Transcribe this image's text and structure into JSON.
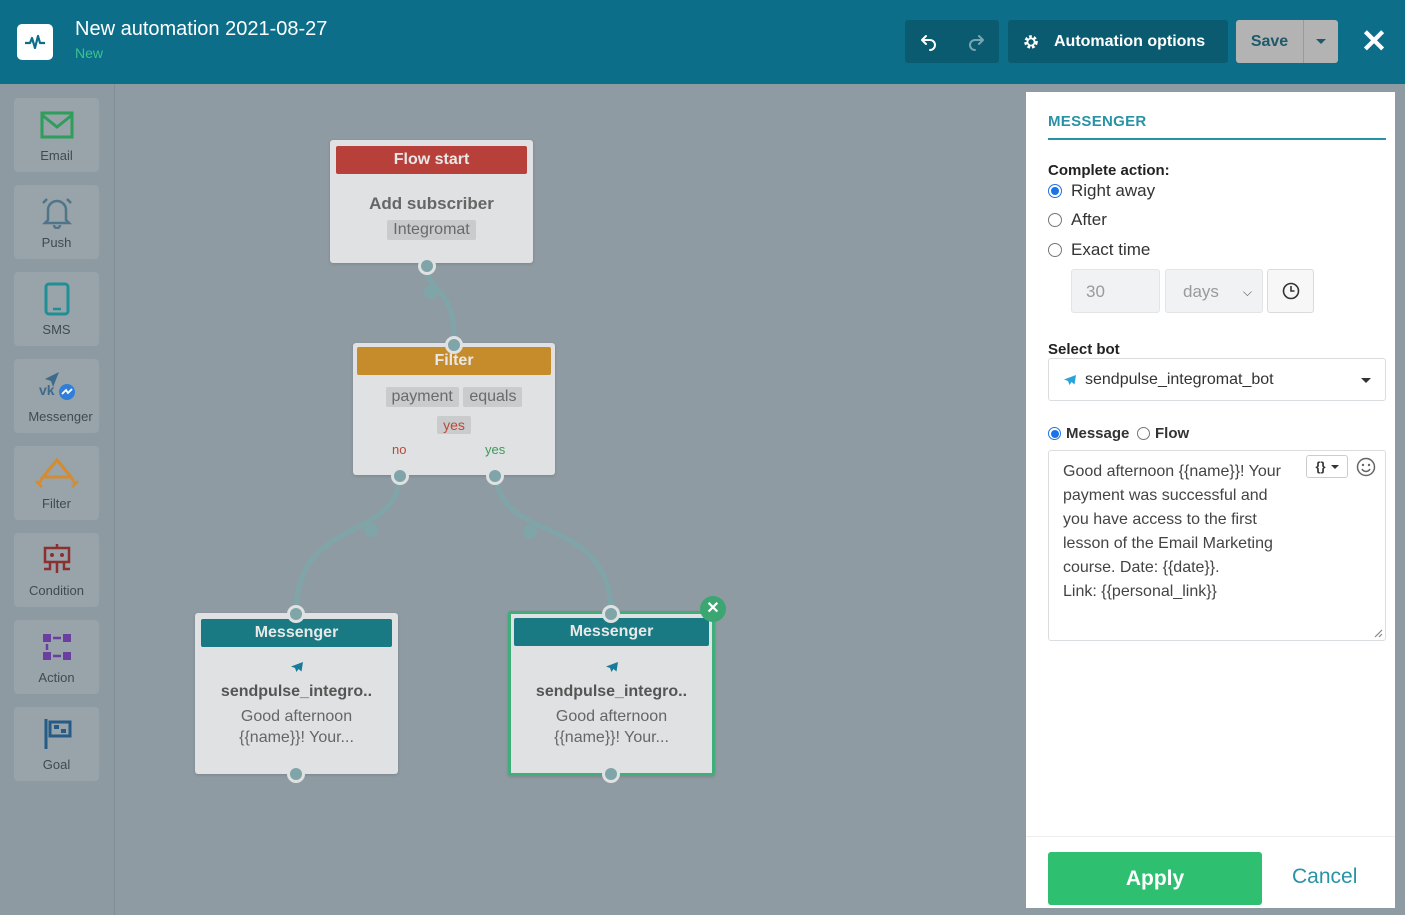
{
  "header": {
    "title": "New automation 2021-08-27",
    "status": "New",
    "undo_icon": "undo-icon",
    "redo_icon": "redo-icon",
    "automation_options_label": "Automation options",
    "save_label": "Save",
    "close_icon": "close-icon"
  },
  "sidebar": {
    "items": [
      {
        "label": "Email",
        "icon": "email-icon"
      },
      {
        "label": "Push",
        "icon": "bell-icon"
      },
      {
        "label": "SMS",
        "icon": "phone-icon"
      },
      {
        "label": "Messenger",
        "icon": "messenger-icon"
      },
      {
        "label": "Filter",
        "icon": "filter-icon"
      },
      {
        "label": "Condition",
        "icon": "condition-icon"
      },
      {
        "label": "Action",
        "icon": "action-icon"
      },
      {
        "label": "Goal",
        "icon": "flag-icon"
      }
    ]
  },
  "flow": {
    "start": {
      "header": "Flow start",
      "title": "Add subscriber",
      "tag": "Integromat"
    },
    "filter": {
      "header": "Filter",
      "field": "payment",
      "operator": "equals",
      "value": "yes",
      "branch_no": "no",
      "branch_yes": "yes"
    },
    "messenger_left": {
      "header": "Messenger",
      "bot": "sendpulse_integro..",
      "preview_line1": "Good afternoon",
      "preview_line2": "{{name}}! Your..."
    },
    "messenger_right": {
      "header": "Messenger",
      "bot": "sendpulse_integro..",
      "preview_line1": "Good afternoon",
      "preview_line2": "{{name}}! Your..."
    }
  },
  "panel": {
    "title": "MESSENGER",
    "complete_action_label": "Complete action:",
    "options": [
      "Right away",
      "After",
      "Exact time"
    ],
    "selected_option": "Right away",
    "delay_value": "30",
    "delay_unit": "days",
    "select_bot_label": "Select bot",
    "bot_name": "sendpulse_integromat_bot",
    "content_tabs": [
      "Message",
      "Flow"
    ],
    "selected_tab": "Message",
    "message_text": "Good afternoon {{name}}! Your payment was successful and you have access to the first lesson of the Email Marketing course. Date: {{date}}.\nLink: {{personal_link}}",
    "variables_label": "{}",
    "apply_label": "Apply",
    "cancel_label": "Cancel"
  },
  "colors": {
    "header_bg": "#0c6e88",
    "flow_start": "#b8403a",
    "filter": "#c68b2a",
    "messenger": "#1a7a83",
    "apply": "#2fbf71",
    "accent": "#2993a6"
  }
}
